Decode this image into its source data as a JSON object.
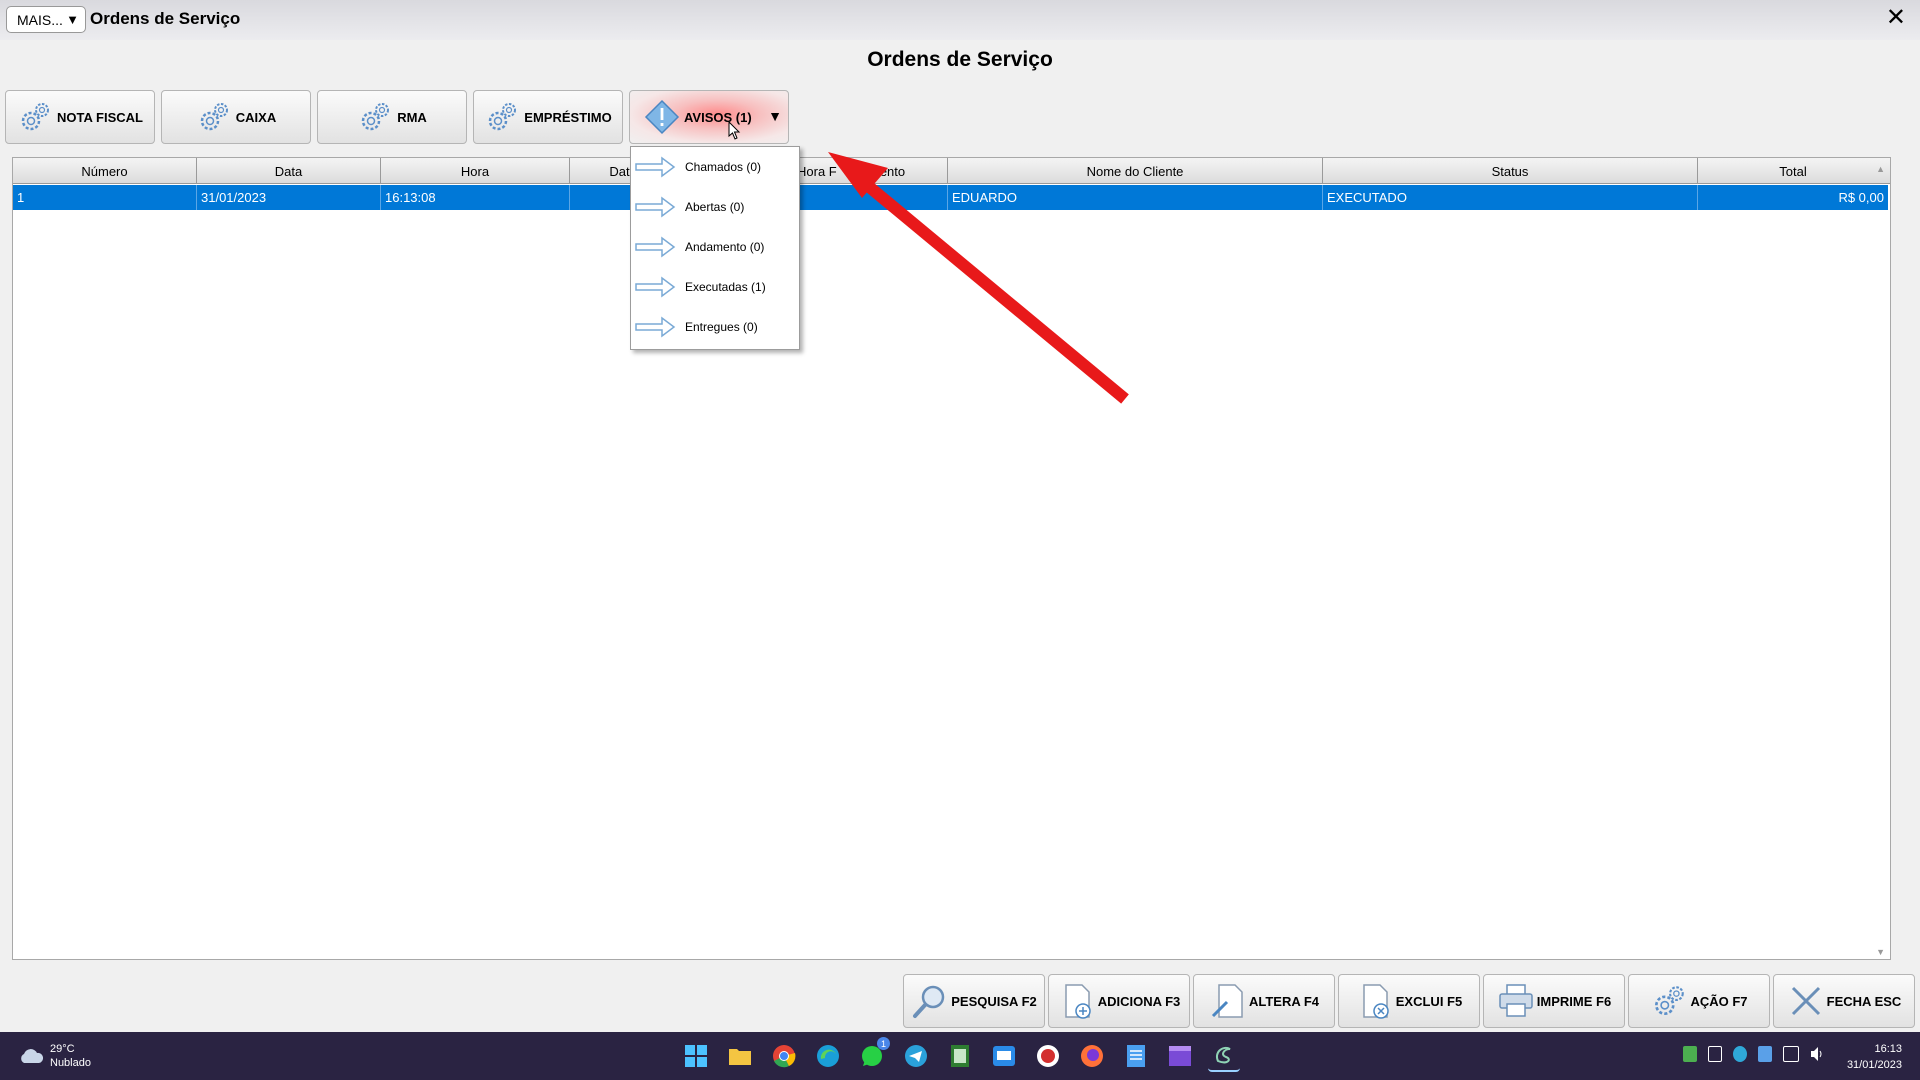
{
  "window": {
    "mais_label": "MAIS...",
    "title": "Ordens de Serviço",
    "close_glyph": "✕"
  },
  "page_title": "Ordens de Serviço",
  "top_buttons": [
    {
      "label": "NOTA FISCAL",
      "icon": "gears-icon"
    },
    {
      "label": "CAIXA",
      "icon": "gears-icon"
    },
    {
      "label": "RMA",
      "icon": "gears-icon"
    },
    {
      "label": "EMPRÉSTIMO",
      "icon": "gears-icon"
    },
    {
      "label": "AVISOS (1)",
      "icon": "warning-diamond-icon"
    }
  ],
  "table": {
    "headers": [
      "Número",
      "Data",
      "Hora",
      "Dat",
      "Hora F",
      "mento",
      "Nome do Cliente",
      "Status",
      "Total"
    ],
    "rows": [
      {
        "numero": "1",
        "data": "31/01/2023",
        "hora": "16:13:08",
        "cliente": "EDUARDO",
        "status": "EXECUTADO",
        "total": "R$ 0,00"
      }
    ]
  },
  "avisos_menu": [
    {
      "label": "Chamados (0)",
      "icon": "arrow-right-icon"
    },
    {
      "label": "Abertas (0)",
      "icon": "arrow-right-icon"
    },
    {
      "label": "Andamento (0)",
      "icon": "arrow-right-icon"
    },
    {
      "label": "Executadas (1)",
      "icon": "arrow-right-icon"
    },
    {
      "label": "Entregues (0)",
      "icon": "arrow-right-icon"
    }
  ],
  "bottom_buttons": [
    {
      "label": "PESQUISA F2",
      "icon": "magnifier-icon"
    },
    {
      "label": "ADICIONA F3",
      "icon": "add-document-icon"
    },
    {
      "label": "ALTERA F4",
      "icon": "edit-document-icon"
    },
    {
      "label": "EXCLUI F5",
      "icon": "delete-document-icon"
    },
    {
      "label": "IMPRIME F6",
      "icon": "printer-icon"
    },
    {
      "label": "AÇÃO F7",
      "icon": "gears-icon"
    },
    {
      "label": "FECHA ESC",
      "icon": "close-x-icon"
    }
  ],
  "taskbar": {
    "weather_temp": "29°C",
    "weather_desc": "Nublado",
    "clock_time": "16:13",
    "clock_date": "31/01/2023",
    "whatsapp_badge": "1",
    "apps": [
      "windows-start-icon",
      "file-explorer-icon",
      "chrome-icon",
      "edge-icon",
      "whatsapp-icon",
      "telegram-icon",
      "sheet-app-icon",
      "remote-app-icon",
      "app-icon",
      "firefox-icon",
      "notepad-icon",
      "clapper-icon",
      "active-app-icon"
    ]
  },
  "colors": {
    "selection_blue": "#0078d7",
    "annotation_red": "#e8191a",
    "taskbar_bg": "#2a2342"
  }
}
